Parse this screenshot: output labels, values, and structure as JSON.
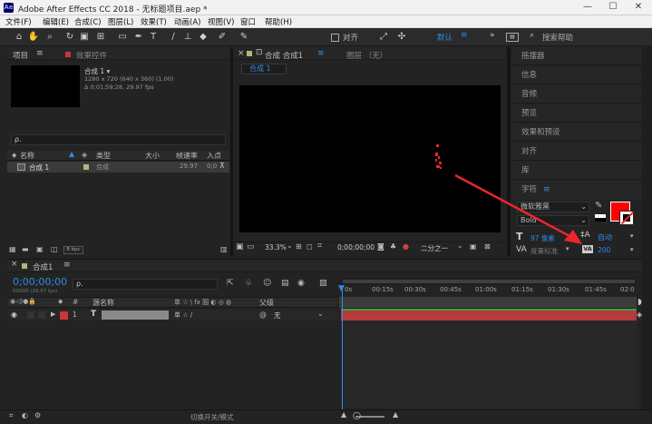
{
  "window": {
    "title": "Adobe After Effects CC 2018 - 无标题项目.aep *",
    "app_icon": "Ae",
    "minimize": "—",
    "maximize": "☐",
    "close": "✕"
  },
  "menu": [
    "文件(F)",
    "编辑(E)",
    "合成(C)",
    "图层(L)",
    "效果(T)",
    "动画(A)",
    "视图(V)",
    "窗口",
    "帮助(H)"
  ],
  "toolbar": {
    "align_label": "对齐",
    "workspace": "默认",
    "search_placeholder": "搜索帮助"
  },
  "project_panel": {
    "tab_project": "项目",
    "tab_effects": "效果控件",
    "comp_name": "合成 1 ▾",
    "comp_info1": "1280 x 720 (640 x 360) (1.00)",
    "comp_info2": "Δ 0;01;59;28, 29.97 fps",
    "search_placeholder": "ρ.",
    "col_name": "名称",
    "col_type": "类型",
    "col_size": "大小",
    "col_fps": "帧速率",
    "col_in": "入点",
    "row_name": "合成 1",
    "row_type": "合成",
    "row_fps": "29.97",
    "row_in": "0;0",
    "bpc": "8 bpc"
  },
  "composition_panel": {
    "tab_comp": "合成 合成1",
    "tab_layer": "图层 （无）",
    "breadcrumb": "合成 1",
    "zoom": "33.3%",
    "timecode": "0;00;00;00",
    "resolution": "二分之一"
  },
  "right_panel": {
    "items": [
      "摇摆器",
      "信息",
      "音频",
      "预览",
      "效果和预设",
      "对齐",
      "库"
    ],
    "character_tab": "字符",
    "font_name": "微软雅黑",
    "font_style": "Bold",
    "font_size": "97 像素",
    "leading": "自动",
    "kerning": "度量标准",
    "tracking": "200",
    "fill_color": "#ff0000",
    "stroke_color": "#ffffff"
  },
  "timeline": {
    "tab": "合成1",
    "timecode": "0;00;00;00",
    "timecode_sub": "00000 (29.97 fps)",
    "search_placeholder": "ρ.",
    "col_source": "源名称",
    "col_switches": "单 ☆ \\ fx 圓 ◐ ◎ ◍",
    "col_parent": "父级",
    "layer_num": "1",
    "layer_type": "T",
    "parent_value": "无",
    "ruler": [
      "0s",
      "00:15s",
      "00:30s",
      "00:45s",
      "01:00s",
      "01:15s",
      "01:30s",
      "01:45s",
      "02:0"
    ],
    "footer_toggle": "切换开关/模式"
  },
  "colors": {
    "accent_blue": "#2d8ceb",
    "layer_bar": "#b53b3b",
    "comp_label": "#b8b27a",
    "arrow_red": "#e8262c"
  }
}
